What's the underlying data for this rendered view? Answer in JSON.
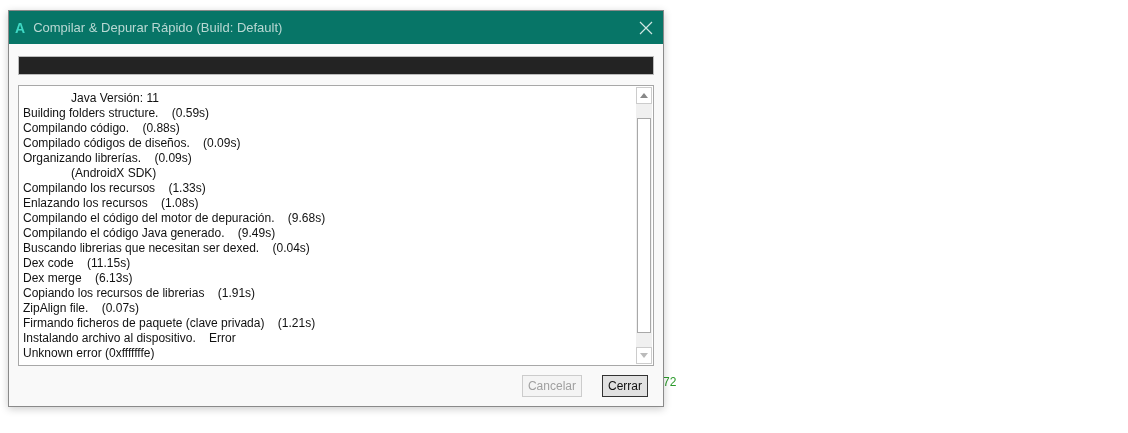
{
  "window": {
    "title": "Compilar & Depurar Rápido (Build: Default)",
    "logo": "A"
  },
  "progress": {
    "level": 1
  },
  "log": [
    {
      "kind": "detail",
      "text": "Java Versión: 11"
    },
    {
      "kind": "step",
      "text": "Building folders structure.    (0.59s)"
    },
    {
      "kind": "step",
      "text": "Compilando código.    (0.88s)"
    },
    {
      "kind": "step",
      "text": "Compilado códigos de diseños.    (0.09s)"
    },
    {
      "kind": "step",
      "text": "Organizando librerías.    (0.09s)"
    },
    {
      "kind": "detail",
      "text": "(AndroidX SDK)"
    },
    {
      "kind": "step",
      "text": "Compilando los recursos    (1.33s)"
    },
    {
      "kind": "step",
      "text": "Enlazando los recursos    (1.08s)"
    },
    {
      "kind": "step",
      "text": "Compilando el código del motor de depuración.    (9.68s)"
    },
    {
      "kind": "step",
      "text": "Compilando el código Java generado.    (9.49s)"
    },
    {
      "kind": "step",
      "text": "Buscando librerias que necesitan ser dexed.    (0.04s)"
    },
    {
      "kind": "step",
      "text": "Dex code    (11.15s)"
    },
    {
      "kind": "step",
      "text": "Dex merge    (6.13s)"
    },
    {
      "kind": "step",
      "text": "Copiando los recursos de librerias    (1.91s)"
    },
    {
      "kind": "step",
      "text": "ZipAlign file.    (0.07s)"
    },
    {
      "kind": "step",
      "text": "Firmando ficheros de paquete (clave privada)    (1.21s)"
    },
    {
      "kind": "step",
      "text": "Instalando archivo al dispositivo.    Error"
    },
    {
      "kind": "step",
      "text": "Unknown error (0xfffffffe)"
    }
  ],
  "buttons": [
    {
      "label": "Cancelar",
      "disabled": true
    },
    {
      "label": "Cerrar",
      "disabled": false
    }
  ],
  "background": {
    "fragment": "72"
  }
}
